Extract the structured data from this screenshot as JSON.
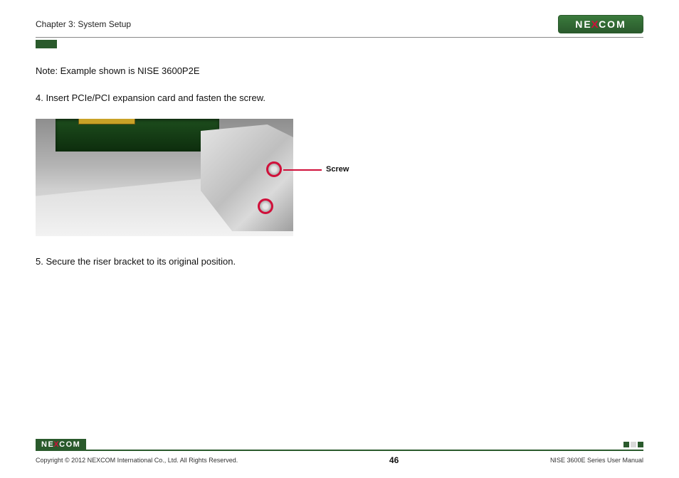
{
  "header": {
    "chapter": "Chapter 3: System Setup",
    "brand_left": "NE",
    "brand_x": "X",
    "brand_right": "COM"
  },
  "body": {
    "note": "Note: Example shown is NISE 3600P2E",
    "step4": "4. Insert PCIe/PCI expansion card and fasten the screw.",
    "callout": "Screw",
    "step5": "5. Secure the riser bracket to its original position."
  },
  "footer": {
    "copyright": "Copyright © 2012 NEXCOM International Co., Ltd. All Rights Reserved.",
    "page": "46",
    "manual": "NISE 3600E Series User Manual"
  }
}
